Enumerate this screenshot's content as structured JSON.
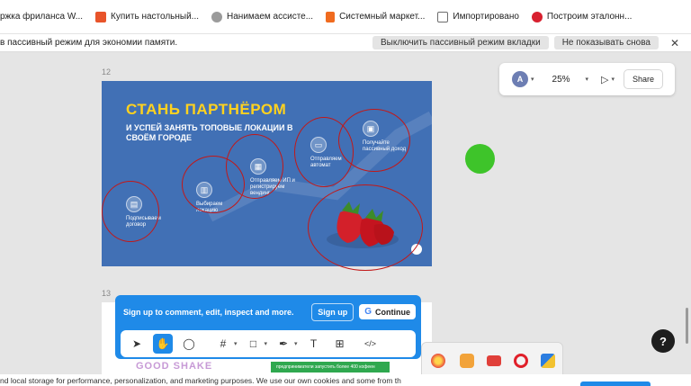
{
  "bookmarks": [
    {
      "label": "ржка фриланса W...",
      "icon": "globe-icon",
      "color": "#ffffff"
    },
    {
      "label": "Купить настольный...",
      "icon": "store-icon",
      "color": "#e8542a"
    },
    {
      "label": "Нанимаем ассисте...",
      "icon": "brain-icon",
      "color": "#9b9b9b"
    },
    {
      "label": "Системный маркет...",
      "icon": "market-icon",
      "color": "#f06b1f"
    },
    {
      "label": "Импортировано",
      "icon": "folder-icon",
      "color": "#6d6d6d"
    },
    {
      "label": "Построим эталонн...",
      "icon": "hh-icon",
      "color": "#d8202f"
    }
  ],
  "infobar": {
    "message": "в пассивный режим для экономии памяти.",
    "disable_label": "Выключить пассивный режим вкладки",
    "dismiss_label": "Не показывать снова",
    "close_glyph": "✕"
  },
  "canvas": {
    "frame12_label": "12",
    "frame13_label": "13",
    "annotation_color": "#c21818",
    "green_dot_color": "#3ec42a"
  },
  "slide12": {
    "headline": "СТАНЬ ПАРТНЁРОМ",
    "subheadline": "И УСПЕЙ ЗАНЯТЬ ТОПОВЫЕ ЛОКАЦИИ В СВОЁМ ГОРОДЕ",
    "steps": [
      {
        "text": "Подписываем договор"
      },
      {
        "text": "Выбираем локацию"
      },
      {
        "text": "Отправляем ИП и регистрируем вендинг"
      },
      {
        "text": "Отправляем автомат"
      },
      {
        "text": "Получайте пассивный доход"
      }
    ]
  },
  "slide13": {
    "brand_text": "GOOD SHAKE",
    "green_text": "предприниматели запустить более 400 кофеен"
  },
  "toolbar_top": {
    "avatar_letter": "A",
    "zoom": "25%",
    "share_label": "Share"
  },
  "signup": {
    "message": "Sign up to comment, edit, inspect and more.",
    "signup_label": "Sign up",
    "continue_label": "Continue",
    "google_glyph": "G"
  },
  "tools": [
    {
      "name": "move-tool",
      "glyph": "➤",
      "caret": false,
      "active": false
    },
    {
      "name": "hand-tool",
      "glyph": "✋",
      "caret": false,
      "active": true
    },
    {
      "name": "comment-tool",
      "glyph": "◯",
      "caret": false,
      "active": false
    },
    {
      "name": "frame-tool",
      "glyph": "#",
      "caret": true,
      "active": false
    },
    {
      "name": "shape-tool",
      "glyph": "□",
      "caret": true,
      "active": false
    },
    {
      "name": "pen-tool",
      "glyph": "✒",
      "caret": true,
      "active": false
    },
    {
      "name": "text-tool",
      "glyph": "T",
      "caret": false,
      "active": false
    },
    {
      "name": "components-tool",
      "glyph": "⊞",
      "caret": false,
      "active": false
    },
    {
      "name": "dev-mode-tool",
      "glyph": "</>",
      "caret": false,
      "active": false
    }
  ],
  "help_glyph": "?",
  "cookie": {
    "message": "nd local storage for performance, personalization, and marketing purposes. We use our own cookies and some from th"
  }
}
